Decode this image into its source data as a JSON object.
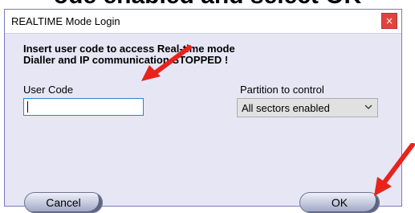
{
  "caption": "ode enabled and  select  OK",
  "window": {
    "title": "REALTIME Mode Login",
    "close_glyph": "×"
  },
  "message": {
    "line1": "Insert user code to access Real-time mode",
    "line2": "Dialler and IP communication STOPPED !"
  },
  "user_code": {
    "label": "User Code",
    "value": ""
  },
  "partition": {
    "label": "Partition to control",
    "selected": "All sectors enabled"
  },
  "buttons": {
    "cancel": "Cancel",
    "ok": "OK"
  },
  "colors": {
    "dialog_bg": "#e6e6f5",
    "close_red": "#e0443e",
    "arrow_red": "#e8231c",
    "input_focus": "#2f7fd6"
  },
  "icons": {
    "close": "close-icon",
    "chevron": "chevron-down-icon",
    "annotation_arrow": "red-arrow-icon"
  }
}
